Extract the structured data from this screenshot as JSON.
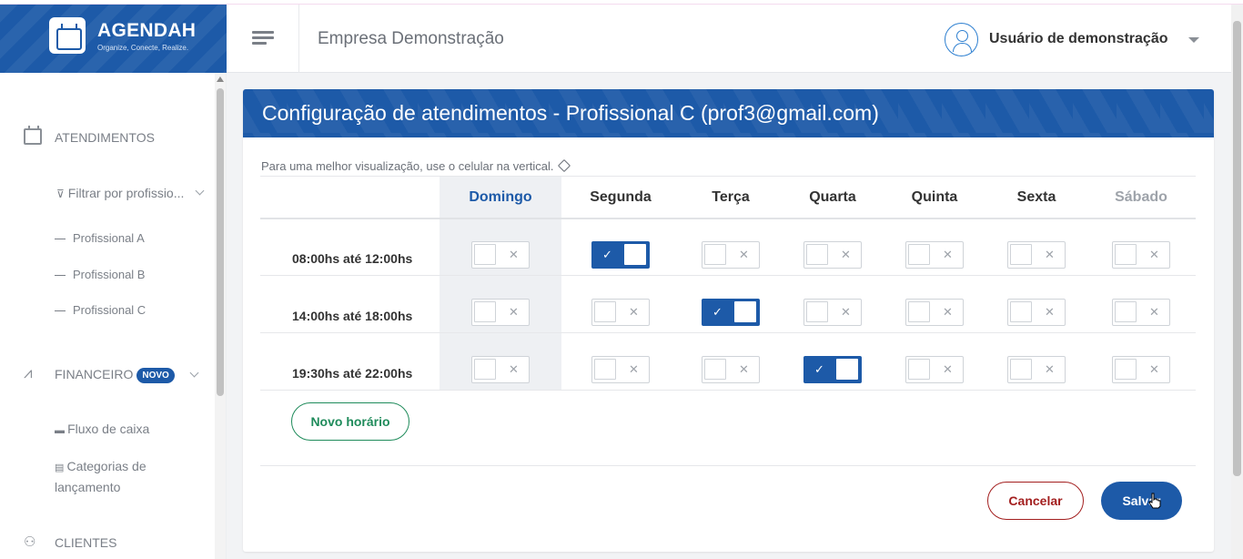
{
  "brand": {
    "title": "AGENDAH",
    "tagline": "Organize, Conecte, Realize."
  },
  "header": {
    "company": "Empresa Demonstração",
    "user_name": "Usuário de demonstração"
  },
  "sidebar": {
    "atendimentos_label": "ATENDIMENTOS",
    "filter_label": "Filtrar por profissio...",
    "professionals": [
      "Profissional A",
      "Profissional B",
      "Profissional C"
    ],
    "financeiro_label": "FINANCEIRO",
    "financeiro_badge": "NOVO",
    "fluxo_label": "Fluxo de caixa",
    "categorias_label_1": "Categorias de",
    "categorias_label_2": "lançamento",
    "clientes_label": "CLIENTES"
  },
  "card": {
    "title": "Configuração de atendimentos - Profissional C (prof3@gmail.com)",
    "hint": "Para uma melhor visualização, use o celular na vertical."
  },
  "schedule": {
    "days": [
      "Domingo",
      "Segunda",
      "Terça",
      "Quarta",
      "Quinta",
      "Sexta",
      "Sábado"
    ],
    "slots": [
      "08:00hs até 12:00hs",
      "14:00hs até 18:00hs",
      "19:30hs até 22:00hs"
    ],
    "enabled": [
      [
        false,
        true,
        false,
        false,
        false,
        false,
        false
      ],
      [
        false,
        false,
        true,
        false,
        false,
        false,
        false
      ],
      [
        false,
        false,
        false,
        true,
        false,
        false,
        false
      ]
    ],
    "on_mark": "✓",
    "off_mark": "✕"
  },
  "actions": {
    "new_slot": "Novo horário",
    "cancel": "Cancelar",
    "save": "Salvar"
  },
  "colors": {
    "primary": "#1d5aa8",
    "success": "#1f8b5b",
    "danger": "#a31f1f"
  }
}
